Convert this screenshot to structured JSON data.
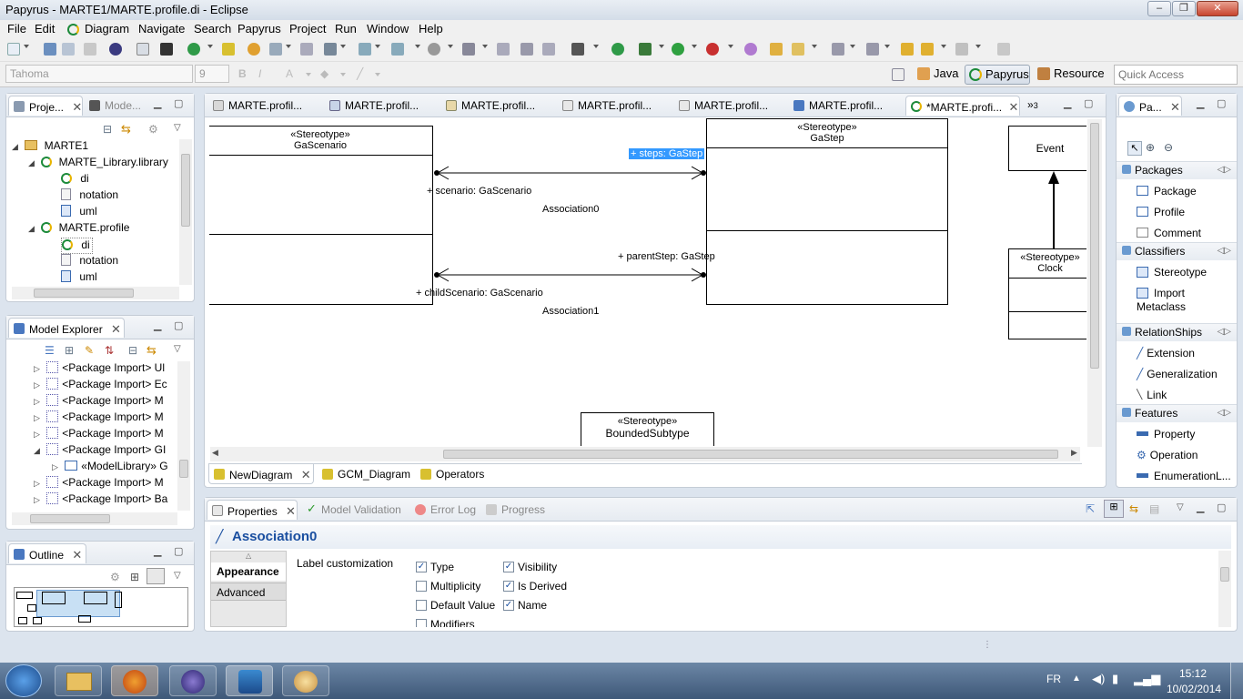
{
  "window": {
    "title": "Papyrus - MARTE1/MARTE.profile.di - Eclipse"
  },
  "menubar": [
    "File",
    "Edit",
    "Diagram",
    "Navigate",
    "Search",
    "Papyrus",
    "Project",
    "Run",
    "Window",
    "Help"
  ],
  "toolbar2": {
    "font_family": "Tahoma",
    "font_size": "9",
    "perspectives": [
      "Java",
      "Papyrus",
      "Resource"
    ],
    "quick_access_placeholder": "Quick Access"
  },
  "project_explorer": {
    "tabs": [
      "Proje...",
      "Mode..."
    ],
    "tree": [
      {
        "label": "MARTE1",
        "level": 0,
        "icon": "folder-icon"
      },
      {
        "label": "MARTE_Library.library",
        "level": 1,
        "icon": "papyrus-model-icon"
      },
      {
        "label": "di",
        "level": 2,
        "icon": "papyrus-model-icon"
      },
      {
        "label": "notation",
        "level": 2,
        "icon": "file-icon"
      },
      {
        "label": "uml",
        "level": 2,
        "icon": "uml-file-icon"
      },
      {
        "label": "MARTE.profile",
        "level": 1,
        "icon": "papyrus-model-icon"
      },
      {
        "label": "di",
        "level": 2,
        "icon": "papyrus-model-icon"
      },
      {
        "label": "notation",
        "level": 2,
        "icon": "file-icon"
      },
      {
        "label": "uml",
        "level": 2,
        "icon": "uml-file-icon"
      }
    ]
  },
  "model_explorer": {
    "title": "Model Explorer",
    "rows": [
      "<Package Import> Ul",
      "<Package Import> Ec",
      "<Package Import> M",
      "<Package Import> M",
      "<Package Import> M",
      "<Package Import> GI",
      "«ModelLibrary» G",
      "<Package Import> M",
      "<Package Import> Ba"
    ]
  },
  "outline": {
    "title": "Outline"
  },
  "editor": {
    "tabs": [
      "MARTE.profil...",
      "MARTE.profil...",
      "MARTE.profil...",
      "MARTE.profil...",
      "MARTE.profil...",
      "MARTE.profil...",
      "*MARTE.profi..."
    ],
    "overflow_count": "3",
    "diagram_tabs": [
      "NewDiagram",
      "GCM_Diagram",
      "Operators"
    ]
  },
  "diagram": {
    "stereotype_label": "«Stereotype»",
    "clock_stereotype": "«Stereotype»",
    "classes": {
      "gascenario": "GaScenario",
      "gastep": "GaStep",
      "event": "Event",
      "clock": "Clock",
      "boundedsubtype": "BoundedSubtype"
    },
    "associations": {
      "assoc0_name": "Association0",
      "assoc0_end_a": "+ steps: GaStep",
      "assoc0_end_b": "+ scenario: GaScenario",
      "assoc1_name": "Association1",
      "assoc1_end_a": "+ parentStep: GaStep",
      "assoc1_end_b": "+ childScenario: GaScenario"
    }
  },
  "palette": {
    "tab": "Pa...",
    "sections": [
      {
        "title": "Packages",
        "items": [
          "Package",
          "Profile",
          "Comment"
        ]
      },
      {
        "title": "Classifiers",
        "items": [
          "Stereotype",
          "Import Metaclass"
        ]
      },
      {
        "title": "RelationShips",
        "items": [
          "Extension",
          "Generalization",
          "Link"
        ]
      },
      {
        "title": "Features",
        "items": [
          "Property",
          "Operation",
          "EnumerationL..."
        ]
      }
    ]
  },
  "properties": {
    "tabs": [
      "Properties",
      "Model Validation",
      "Error Log",
      "Progress"
    ],
    "title": "Association0",
    "side_tabs": [
      "Appearance",
      "Advanced"
    ],
    "label_customization": "Label customization",
    "checkboxes": [
      {
        "label": "Type",
        "checked": true
      },
      {
        "label": "Multiplicity",
        "checked": false
      },
      {
        "label": "Default Value",
        "checked": false
      },
      {
        "label": "Modifiers",
        "checked": false
      },
      {
        "label": "Visibility",
        "checked": true
      },
      {
        "label": "Is Derived",
        "checked": true
      },
      {
        "label": "Name",
        "checked": true
      }
    ]
  },
  "taskbar": {
    "language": "FR",
    "time": "15:12",
    "date": "10/02/2014"
  },
  "colors": {
    "selection": "#3399ff",
    "accent": "#1a4fa0"
  }
}
